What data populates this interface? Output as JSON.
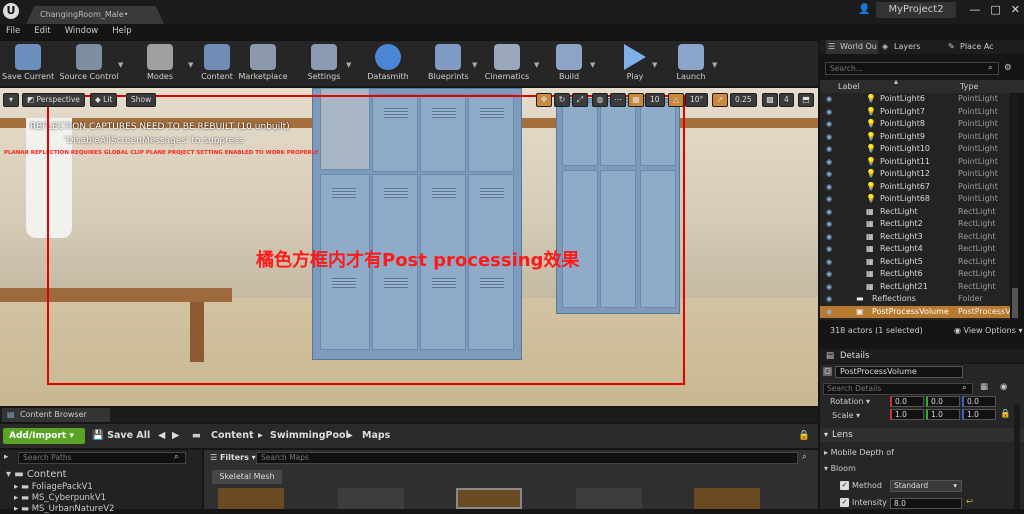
{
  "titlebar": {
    "tab_title": "ChangingRoom_Male•",
    "project_name": "MyProject2",
    "logo": "U",
    "controls": [
      "—",
      "□",
      "✕"
    ]
  },
  "menu": [
    "File",
    "Edit",
    "Window",
    "Help"
  ],
  "toolbar": {
    "buttons": [
      {
        "label": "Save Current",
        "icon": "save-icon",
        "color": "#6c8fc0"
      },
      {
        "label": "Source Control",
        "icon": "source-control-icon",
        "color": "#7d8ea3"
      },
      {
        "label": "Modes",
        "icon": "modes-icon",
        "color": "#a0a0a0"
      },
      {
        "label": "Content",
        "icon": "content-icon",
        "color": "#6f8bb6"
      },
      {
        "label": "Marketplace",
        "icon": "marketplace-icon",
        "color": "#8c99ad"
      },
      {
        "label": "Settings",
        "icon": "settings-icon",
        "color": "#8b9bb3"
      },
      {
        "label": "Datasmith",
        "icon": "datasmith-icon",
        "color": "#4c86d6"
      },
      {
        "label": "Blueprints",
        "icon": "blueprints-icon",
        "color": "#7f9ac3"
      },
      {
        "label": "Cinematics",
        "icon": "cinematics-icon",
        "color": "#9aa7bd"
      },
      {
        "label": "Build",
        "icon": "build-icon",
        "color": "#8ea5c8"
      },
      {
        "label": "Play",
        "icon": "play-icon",
        "color": "#7fb0e8"
      },
      {
        "label": "Launch",
        "icon": "launch-icon",
        "color": "#8aa6cd"
      }
    ]
  },
  "viewport": {
    "perspective": "Perspective",
    "lit": "Lit",
    "show": "Show",
    "grid_snap": "10",
    "rot_snap": "10°",
    "scale_snap": "0.25",
    "cam_speed": "4",
    "msg_reflection": "REFLECTION CAPTURES NEED TO BE REBUILT (10 unbuilt)",
    "msg_disable": "'DisableAllScreenMessages' to suppress",
    "msg_planar": "PLANAR REFLECTION REQUIRES GLOBAL CLIP PLANE PROJECT SETTING ENABLED TO WORK PROPERLY",
    "annotation": "橘色方框内才有Post processing效果",
    "annotation_color": "#ff1a1a"
  },
  "content_browser": {
    "tab": "Content Browser",
    "add_import": "Add/Import ▾",
    "save_all": "Save All",
    "breadcrumbs": [
      "Content",
      "SwimmingPool",
      "Maps"
    ],
    "search_paths_placeholder": "Search Paths",
    "filters": "Filters ▾",
    "search_maps_placeholder": "Search Maps",
    "filter_chip": "Skeletal Mesh",
    "tree": [
      "Content",
      "FoliagePackV1",
      "MS_CyberpunkV1",
      "MS_UrbanNatureV2"
    ]
  },
  "outliner": {
    "tabs": [
      "World Ou",
      "Layers",
      "Place Ac"
    ],
    "search_placeholder": "Search...",
    "col_label": "Label",
    "col_type": "Type",
    "rows": [
      {
        "name": "PointLight6",
        "type": "PointLight",
        "icon": "bulb"
      },
      {
        "name": "PointLight7",
        "type": "PointLight",
        "icon": "bulb"
      },
      {
        "name": "PointLight8",
        "type": "PointLight",
        "icon": "bulb"
      },
      {
        "name": "PointLight9",
        "type": "PointLight",
        "icon": "bulb"
      },
      {
        "name": "PointLight10",
        "type": "PointLight",
        "icon": "bulb"
      },
      {
        "name": "PointLight11",
        "type": "PointLight",
        "icon": "bulb"
      },
      {
        "name": "PointLight12",
        "type": "PointLight",
        "icon": "bulb"
      },
      {
        "name": "PointLight67",
        "type": "PointLight",
        "icon": "bulb"
      },
      {
        "name": "PointLight68",
        "type": "PointLight",
        "icon": "bulb"
      },
      {
        "name": "RectLight",
        "type": "RectLight",
        "icon": "rect"
      },
      {
        "name": "RectLight2",
        "type": "RectLight",
        "icon": "rect"
      },
      {
        "name": "RectLight3",
        "type": "RectLight",
        "icon": "rect"
      },
      {
        "name": "RectLight4",
        "type": "RectLight",
        "icon": "rect"
      },
      {
        "name": "RectLight5",
        "type": "RectLight",
        "icon": "rect"
      },
      {
        "name": "RectLight6",
        "type": "RectLight",
        "icon": "rect"
      },
      {
        "name": "RectLight21",
        "type": "RectLight",
        "icon": "rect"
      },
      {
        "name": "Reflections",
        "type": "Folder",
        "icon": "folder"
      },
      {
        "name": "PostProcessVolume",
        "type": "PostProcessV",
        "icon": "volume",
        "selected": true
      }
    ],
    "footer_count": "318 actors (1 selected)",
    "footer_view": "◉ View Options ▾"
  },
  "details": {
    "tab": "Details",
    "name_value": "PostProcessVolume",
    "search_placeholder": "Search Details",
    "rotation_label": "Rotation ▾",
    "rotation": [
      "0.0",
      "0.0",
      "0.0"
    ],
    "scale_label": "Scale ▾",
    "scale": [
      "1.0",
      "1.0",
      "1.0"
    ],
    "section_lens": "Lens",
    "mobile_dof": "Mobile Depth of",
    "bloom": "Bloom",
    "method_label": "Method",
    "method_value": "Standard",
    "intensity_label": "Intensity",
    "intensity_value": "8.0"
  }
}
